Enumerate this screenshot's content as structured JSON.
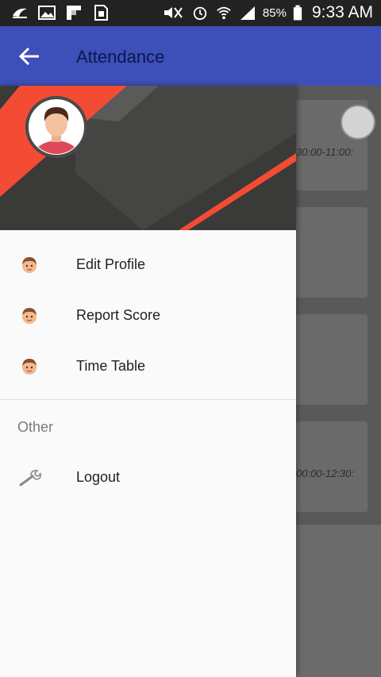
{
  "status_bar": {
    "battery_percent": "85%",
    "time": "9:33 AM",
    "icons": [
      "bird-icon",
      "image-icon",
      "flipboard-icon",
      "sim-icon",
      "mute-icon",
      "alarm-icon",
      "wifi-icon",
      "signal-icon",
      "battery-icon"
    ]
  },
  "app_bar": {
    "title": "Attendance",
    "back_icon": "arrow-back-icon"
  },
  "background": {
    "card_times": [
      "30:00-11:00:",
      "00:00-12:30:"
    ]
  },
  "drawer": {
    "items": [
      {
        "label": "Edit Profile",
        "icon": "boy-face-icon"
      },
      {
        "label": "Report Score",
        "icon": "boy-face-icon"
      },
      {
        "label": "Time Table",
        "icon": "boy-face-icon"
      }
    ],
    "subheader": "Other",
    "other_items": [
      {
        "label": "Logout",
        "icon": "wrench-icon"
      }
    ]
  },
  "colors": {
    "app_bar": "#3d4fb8",
    "header_red": "#f44b35",
    "header_dark": "#3a3a38"
  }
}
